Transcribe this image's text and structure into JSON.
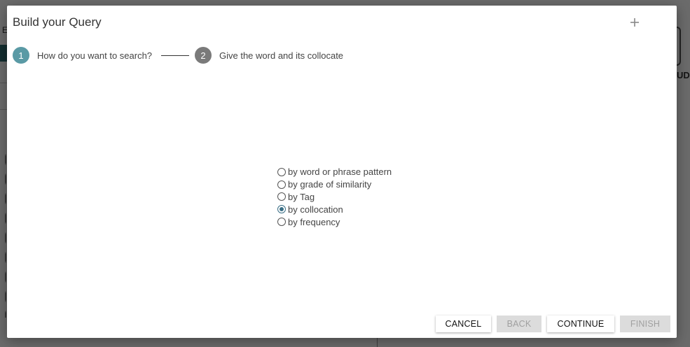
{
  "background": {
    "letter_left": "E",
    "letter_right": "UD"
  },
  "modal": {
    "title": "Build your Query",
    "close_icon": "plus-icon"
  },
  "stepper": {
    "steps": [
      {
        "number": "1",
        "label": "How do you want to search?",
        "color": "#5a9aa5",
        "active": true
      },
      {
        "number": "2",
        "label": "Give the word and its collocate",
        "color": "#7a7a7a",
        "active": false
      }
    ]
  },
  "search_options": {
    "selected": "by collocation",
    "options": [
      {
        "label": "by word or phrase pattern",
        "checked": false
      },
      {
        "label": "by grade of similarity",
        "checked": false
      },
      {
        "label": "by Tag",
        "checked": false
      },
      {
        "label": "by collocation",
        "checked": true
      },
      {
        "label": "by frequency",
        "checked": false
      }
    ]
  },
  "footer": {
    "cancel": "CANCEL",
    "back": "BACK",
    "continue": "CONTINUE",
    "finish": "FINISH"
  },
  "colors": {
    "accent": "#3a6f86",
    "step_active": "#5a9aa5",
    "step_inactive": "#7a7a7a",
    "disabled_button": "#dcdcdc"
  }
}
